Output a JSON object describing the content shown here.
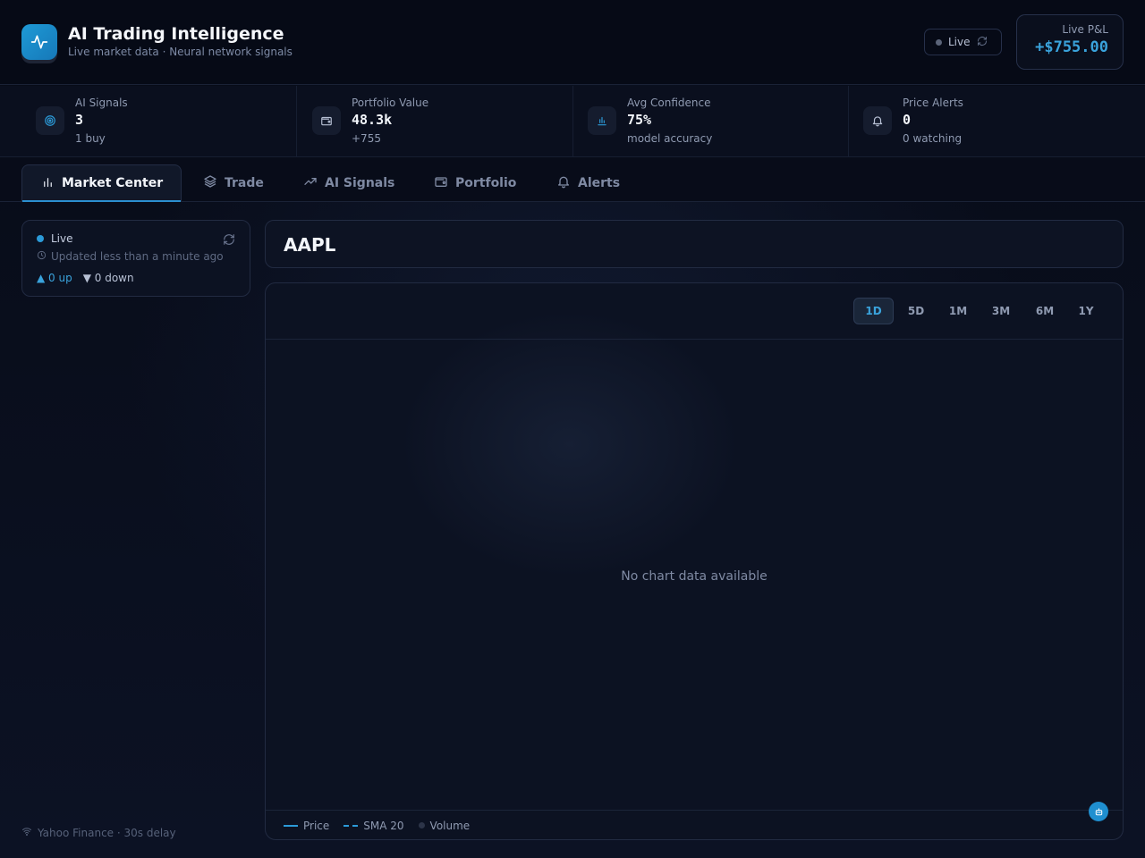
{
  "header": {
    "title": "AI Trading Intelligence",
    "subtitle": "Live market data · Neural network signals",
    "logo_icon": "pulse-icon",
    "live_label": "Live",
    "pnl_label": "Live P&L",
    "pnl_value": "+$755.00"
  },
  "stats": [
    {
      "label": "AI Signals",
      "value": "3",
      "sub": "1 buy",
      "icon": "target-icon"
    },
    {
      "label": "Portfolio Value",
      "value": "48.3k",
      "sub": "+755",
      "icon": "wallet-icon"
    },
    {
      "label": "Avg Confidence",
      "value": "75%",
      "sub": "model accuracy",
      "icon": "bar-chart-icon"
    },
    {
      "label": "Price Alerts",
      "value": "0",
      "sub": "0 watching",
      "icon": "bell-icon"
    }
  ],
  "tabs": [
    {
      "label": "Market Center",
      "icon": "bar-chart-icon",
      "active": true
    },
    {
      "label": "Trade",
      "icon": "layers-icon",
      "active": false
    },
    {
      "label": "AI Signals",
      "icon": "trending-up-icon",
      "active": false
    },
    {
      "label": "Portfolio",
      "icon": "wallet-icon",
      "active": false
    },
    {
      "label": "Alerts",
      "icon": "bell-icon",
      "active": false
    }
  ],
  "status": {
    "live": "Live",
    "updated": "Updated less than a minute ago",
    "up": "▲ 0 up",
    "down": "▼ 0 down"
  },
  "symbol": "AAPL",
  "chart": {
    "ranges": [
      "1D",
      "5D",
      "1M",
      "3M",
      "6M",
      "1Y"
    ],
    "active_range": "1D",
    "empty_message": "No chart data available",
    "legend": [
      "Price",
      "SMA 20",
      "Volume"
    ]
  },
  "footer": {
    "source": "Yahoo Finance · 30s delay"
  },
  "colors": {
    "accent": "#2b9ad8",
    "background": "#0b1020"
  }
}
